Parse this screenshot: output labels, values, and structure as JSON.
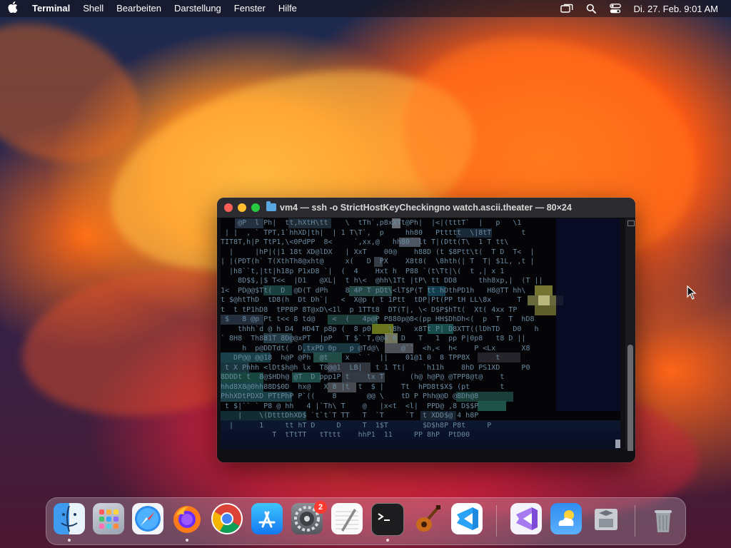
{
  "menubar": {
    "app_name": "Terminal",
    "items": [
      "Shell",
      "Bearbeiten",
      "Darstellung",
      "Fenster",
      "Hilfe"
    ],
    "clock": "Di. 27. Feb.  9:01 AM",
    "icons": [
      "screen-mirror-icon",
      "spotlight-search-icon",
      "control-center-icon"
    ]
  },
  "terminal": {
    "title": "vm4 — ssh -o StrictHostKeyCheckingno watch.ascii.theater — 80×24",
    "lines": [
      "    @P  l Ph|  tt,hXtH\\tt    \\  tTh`,p8xXTt@Ph|  |<|(tttT`  |   p   \\1  ",
      " | |  , ` TPT,1`hhXD|th|  | 1 T\\T`,  p     hh80   Pttttt  \\|8tT       t",
      "TIT8T,h|P TtP1,\\<0PdPP  8<     `,xx,@   hh80  lt T|(Dtt(T\\  1 T tt\\   ",
      "  |     |hP|(|1 18t XD@lDX   | XxT    00@    h88D (t $8Ptt\\t(  T D  T<  |",
      "| |(PDT(h` T(XthTh8@xht@     x(   D  PX    X8t8(  \\8hth(| T  T| $1L, ,t |",
      "  |h8``t,|tt|h18p P1xD8 `|  (  4    Hxt h  P88 `(t\\Tt|\\(  t ,| x 1     ",
      "    8D$$,|$ T<<  |D1   @XL|  t h\\<  @hh\\1Tt |tP\\ tt DD8     thh8xp,|  (T ||",
      "1<  PD@@$Tt(  D  @D(T dPh    8 4P T pDt\\<lT$P(T tt hDthPD1h   H8@TT hh\\ ",
      "t $@htThD  tD8(h  Dt Dh`|   <  X@p ( t 1Ptt  tDP|Pt(PP tH LL\\8x      T ",
      "t  t tP1hD8  tPP8P 8T@xD\\<1l  p 1TTt8  DT(T|, \\< D$P$hTt(  Xt( 4xx TP   ",
      " $   8 @p Pt t<< 8 td@    <  (   4p@P P880p@8<(pp HH$DhDh<(  p  T  T  hD8  ",
      "    thhh`d @ h D4  HD4T p8p (  8 p0    \\8h   x8Tt P| D8XTT((lDhTD   D0   h ",
      "` 8H8  Th881T 8D@@xPT  |pP   T $``T,@@4 8 D   T   1  pp P|0p8   t8 D ||  ",
      "     h  p@DDTdt(  D,txPD 0p   p @Td@\\     @``  <h,<  h<    P <Lx      X8  ",
      "   DP@@ @@18  h@P @Ph  @t    x  ` `  ||    01@1 0  8 TPP8X      t       ",
      " t X Phhh <lDt$h@h lx  T8@@1  LB|   t 1 Tt|    `h11h    8hD PS1XD     P0  ",
      "8DDDt t  8@$HDh@ @T  D ppp1P t    tx T      (h@ h@P@ @TPP8@t@    t      ",
      "hhd8X8@0hh88D$0D  hx@   X 8 |t  t  $ |    Tt  hPD8t$X$ (pt       t      ",
      "PhhXDtPDXD PTtPhP P`((    8       @@ \\    tD P Phh@@D @8Dh@8         ",
      " t $|`` ` P8 @ hh   4 |`Th\\ T    @   |x<t  <l|  PPD@ ,8 D$$P         ",
      "    |    \\(DtttDhXD$ `t`t`T TT   T  `T     `T  t XDD$@ 4 h8P         ",
      "  |      1     tt hT D     D     T  1$T        $D$h8P P8t     P         ",
      "            T  tTtTT   tTttt    hhP1  11     PP 8hP  PtD00            "
    ]
  },
  "dock": {
    "items": [
      {
        "name": "Finder",
        "icon": "finder-icon",
        "running": true
      },
      {
        "name": "Launchpad",
        "icon": "launchpad-icon",
        "running": false
      },
      {
        "name": "Safari",
        "icon": "safari-icon",
        "running": false
      },
      {
        "name": "Firefox",
        "icon": "firefox-icon",
        "running": true
      },
      {
        "name": "Google Chrome",
        "icon": "chrome-icon",
        "running": false
      },
      {
        "name": "App Store",
        "icon": "app-store-icon",
        "running": false
      },
      {
        "name": "Systemeinstellungen",
        "icon": "system-settings-icon",
        "running": false,
        "badge": "2"
      },
      {
        "name": "TextEdit",
        "icon": "textedit-icon",
        "running": false
      },
      {
        "name": "Terminal",
        "icon": "terminal-icon",
        "running": true
      },
      {
        "name": "GarageBand",
        "icon": "garageband-icon",
        "running": false
      },
      {
        "name": "Visual Studio Code",
        "icon": "vscode-icon",
        "running": false
      },
      {
        "name": "Visual Studio",
        "icon": "visual-studio-icon",
        "running": false
      },
      {
        "name": "Wetter",
        "icon": "weather-icon",
        "running": false
      },
      {
        "name": "Boot Camp Assistent",
        "icon": "bootcamp-icon",
        "running": false
      },
      {
        "name": "Papierkorb",
        "icon": "trash-icon",
        "running": false
      }
    ],
    "badge": "2"
  },
  "colors": {
    "menubar_bg": "#140e16",
    "terminal_bg": "#050508",
    "titlebar_bg": "#2c2c30",
    "traffic_red": "#ff5f57",
    "traffic_yellow": "#febc2e",
    "traffic_green": "#28c840",
    "badge_red": "#ff3b30"
  }
}
